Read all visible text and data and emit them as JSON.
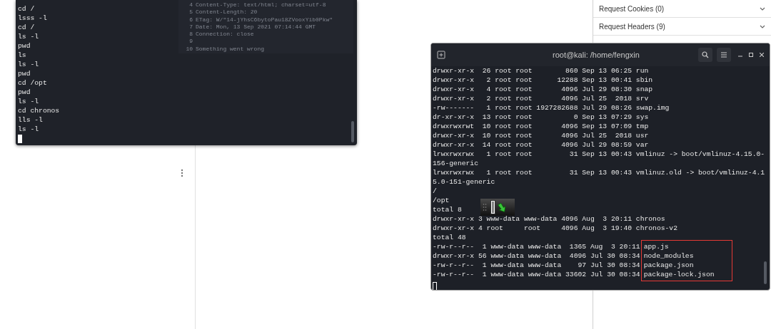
{
  "left_terminal": {
    "lines": [
      "cd /",
      "lsss -l",
      "cd /",
      "ls -l",
      "pwd",
      "ls",
      "ls -l",
      "pwd",
      "cd /opt",
      "pwd",
      "ls -l",
      "cd chronos",
      "lls -l",
      "ls -l"
    ],
    "background_code": [
      {
        "number": "4",
        "text": "Content-Type: text/html; charset=utf-8"
      },
      {
        "number": "5",
        "text": "Content-Length: 20"
      },
      {
        "number": "6",
        "text": "ETag: W/\"14-jYhsC6bytoPau18ZVooxYib0Pkw\""
      },
      {
        "number": "7",
        "text": "Date: Mon, 13 Sep 2021 07:14:44 GMT"
      },
      {
        "number": "8",
        "text": "Connection: close"
      },
      {
        "number": "9"
      },
      {
        "number": "10",
        "text": "Something went wrong"
      }
    ]
  },
  "side_panel": {
    "sections": [
      {
        "label": "Request Cookies (0)"
      },
      {
        "label": "Request Headers (9)"
      }
    ]
  },
  "terminal": {
    "title": "root@kali: /home/fengxin",
    "lines": [
      "drwxr-xr-x  26 root root        860 Sep 13 06:25 run",
      "drwxr-xr-x   2 root root      12288 Sep 13 00:41 sbin",
      "drwxr-xr-x   4 root root       4096 Jul 29 08:30 snap",
      "drwxr-xr-x   2 root root       4096 Jul 25  2018 srv",
      "-rw-------   1 root root 1927282688 Jul 29 08:26 swap.img",
      "dr-xr-xr-x  13 root root          0 Sep 13 07:29 sys",
      "drwxrwxrwt  10 root root       4096 Sep 13 07:09 tmp",
      "drwxr-xr-x  10 root root       4096 Jul 25  2018 usr",
      "drwxr-xr-x  14 root root       4096 Jul 29 08:59 var",
      "lrwxrwxrwx   1 root root         31 Sep 13 00:43 vmlinuz -> boot/vmlinuz-4.15.0-",
      "156-generic",
      "lrwxrwxrwx   1 root root         31 Sep 13 00:43 vmlinuz.old -> boot/vmlinuz-4.1",
      "5.0-151-generic",
      "/",
      "/opt",
      "total 8",
      "drwxr-xr-x 3 www-data www-data 4096 Aug  3 20:11 chronos",
      "drwxr-xr-x 4 root     root     4096 Aug  3 19:40 chronos-v2",
      "total 48"
    ],
    "listing": [
      {
        "meta": "-rw-r--r--  1 www-data www-data  1365 Aug  3 20:11",
        "name": "app.js"
      },
      {
        "meta": "drwxr-xr-x 56 www-data www-data  4096 Jul 30 08:34",
        "name": "node_modules"
      },
      {
        "meta": "-rw-r--r--  1 www-data www-data    97 Jul 30 08:34",
        "name": "package.json"
      },
      {
        "meta": "-rw-r--r--  1 www-data www-data 33602 Jul 30 08:34",
        "name": "package-lock.json"
      }
    ]
  }
}
